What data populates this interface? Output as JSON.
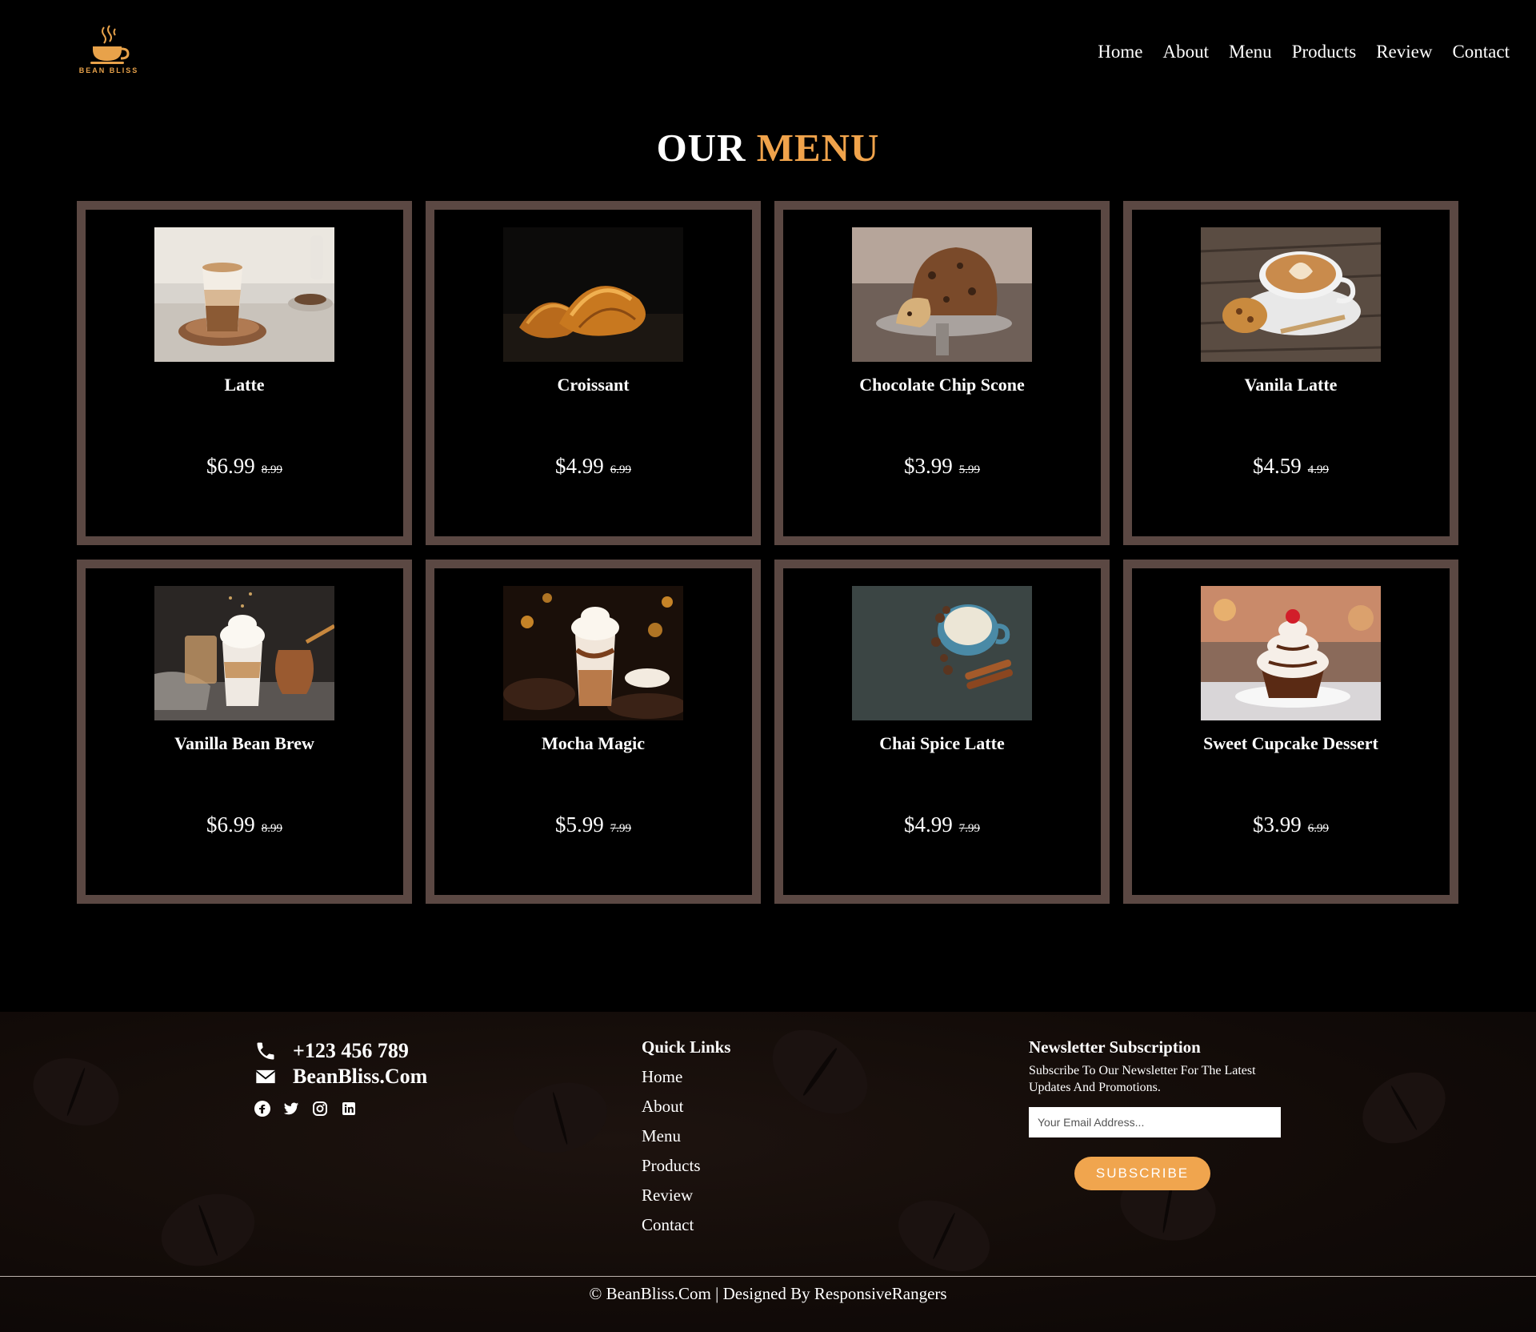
{
  "brand": {
    "logo_text": "BEAN BLISS",
    "accent_color": "#f0a34b"
  },
  "nav": [
    "Home",
    "About",
    "Menu",
    "Products",
    "Review",
    "Contact"
  ],
  "menu": {
    "title_part1": "OUR",
    "title_part2": "MENU",
    "items": [
      {
        "name": "Latte",
        "price": "$6.99",
        "old_price": "8.99",
        "image": "latte"
      },
      {
        "name": "Croissant",
        "price": "$4.99",
        "old_price": "6.99",
        "image": "croissant"
      },
      {
        "name": "Chocolate Chip Scone",
        "price": "$3.99",
        "old_price": "5.99",
        "image": "scone"
      },
      {
        "name": "Vanila Latte",
        "price": "$4.59",
        "old_price": "4.99",
        "image": "vanilla-latte"
      },
      {
        "name": "Vanilla Bean Brew",
        "price": "$6.99",
        "old_price": "8.99",
        "image": "vanilla-bean-brew"
      },
      {
        "name": "Mocha Magic",
        "price": "$5.99",
        "old_price": "7.99",
        "image": "mocha"
      },
      {
        "name": "Chai Spice Latte",
        "price": "$4.99",
        "old_price": "7.99",
        "image": "chai"
      },
      {
        "name": "Sweet Cupcake Dessert",
        "price": "$3.99",
        "old_price": "6.99",
        "image": "cupcake"
      }
    ]
  },
  "footer": {
    "phone": "+123 456 789",
    "email": "BeanBliss.Com",
    "socials": [
      "facebook-icon",
      "twitter-icon",
      "instagram-icon",
      "linkedin-icon"
    ],
    "quick_links_heading": "Quick Links",
    "quick_links": [
      "Home",
      "About",
      "Menu",
      "Products",
      "Review",
      "Contact"
    ],
    "newsletter_heading": "Newsletter Subscription",
    "newsletter_text": "Subscribe To Our Newsletter For The Latest Updates And Promotions.",
    "email_placeholder": "Your Email Address...",
    "subscribe_label": "SUBSCRIBE",
    "copyright": "© BeanBliss.Com | Designed By ResponsiveRangers"
  }
}
